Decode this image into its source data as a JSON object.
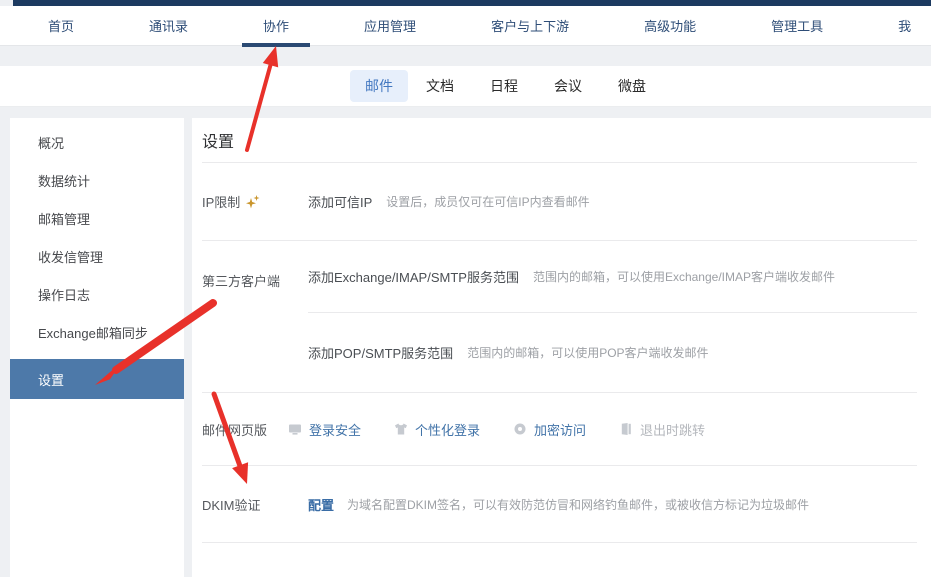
{
  "top_nav": {
    "items": [
      "首页",
      "通讯录",
      "协作",
      "应用管理",
      "客户与上下游",
      "高级功能",
      "管理工具",
      "我"
    ],
    "active": "协作"
  },
  "app_tabs": {
    "items": [
      "邮件",
      "文档",
      "日程",
      "会议",
      "微盘"
    ],
    "active": "邮件"
  },
  "sidebar": {
    "items": [
      "概况",
      "数据统计",
      "邮箱管理",
      "收发信管理",
      "操作日志",
      "Exchange邮箱同步",
      "设置"
    ],
    "active": "设置"
  },
  "main": {
    "title": "设置",
    "ip_row": {
      "label": "IP限制",
      "premium_icon": "sparkle-icon",
      "action": "添加可信IP",
      "desc": "设置后，成员仅可在可信IP内查看邮件"
    },
    "third_party_row": {
      "label": "第三方客户端",
      "sub_rows": [
        {
          "action": "添加Exchange/IMAP/SMTP服务范围",
          "desc": "范围内的邮箱，可以使用Exchange/IMAP客户端收发邮件"
        },
        {
          "action": "添加POP/SMTP服务范围",
          "desc": "范围内的邮箱，可以使用POP客户端收发邮件"
        }
      ]
    },
    "webmail_row": {
      "label": "邮件网页版",
      "links": [
        {
          "icon": "monitor-icon",
          "label": "登录安全",
          "state": "enabled"
        },
        {
          "icon": "tshirt-icon",
          "label": "个性化登录",
          "state": "enabled"
        },
        {
          "icon": "shield-icon",
          "label": "加密访问",
          "state": "enabled"
        },
        {
          "icon": "door-icon",
          "label": "退出时跳转",
          "state": "disabled"
        }
      ]
    },
    "dkim_row": {
      "label": "DKIM验证",
      "action": "配置",
      "desc": "为域名配置DKIM签名，可以有效防范仿冒和网络钓鱼邮件，或被收信方标记为垃圾邮件"
    }
  },
  "annotations": {
    "arrow_color": "#e8312a",
    "arrows": [
      "points-to-top-nav-collaboration",
      "points-to-sidebar-settings",
      "points-to-dkim-row"
    ]
  },
  "colors": {
    "topbar": "#1c3a60",
    "nav_text": "#2e4d77",
    "sidebar_selected": "#4d79a9",
    "tab_pill_bg": "#e7effb",
    "link_blue": "#4173a8",
    "premium_gold": "#c9952c"
  }
}
